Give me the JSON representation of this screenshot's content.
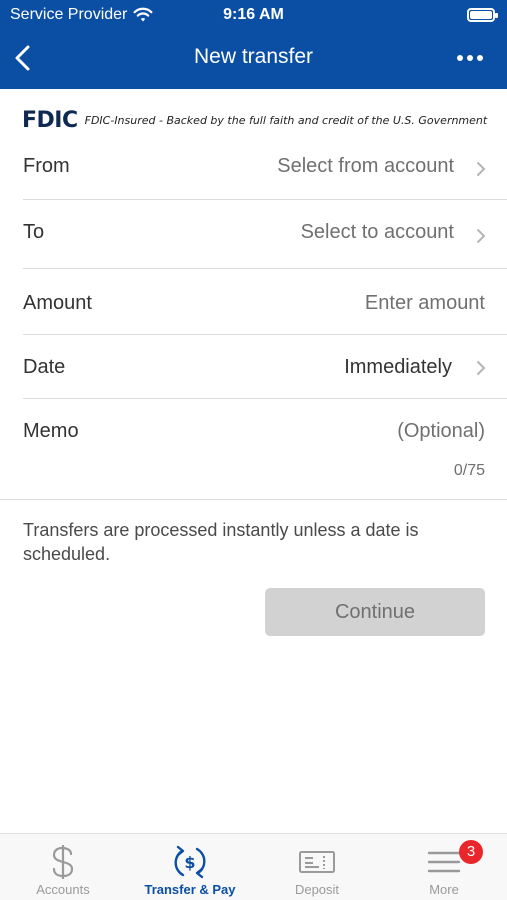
{
  "status_bar": {
    "carrier": "Service Provider",
    "time": "9:16 AM"
  },
  "header": {
    "title": "New transfer"
  },
  "fdic": {
    "logo": "FDIC",
    "text": "FDIC-Insured - Backed by the full faith and credit of the U.S. Government"
  },
  "form": {
    "from": {
      "label": "From",
      "value": "Select from account"
    },
    "to": {
      "label": "To",
      "value": "Select to account"
    },
    "amount": {
      "label": "Amount",
      "placeholder": "Enter amount"
    },
    "date": {
      "label": "Date",
      "value": "Immediately"
    },
    "memo": {
      "label": "Memo",
      "placeholder": "(Optional)",
      "counter": "0/75"
    }
  },
  "note": "Transfers are processed instantly unless a date is scheduled.",
  "continue_label": "Continue",
  "tabs": [
    {
      "label": "Accounts",
      "icon": "dollar-icon"
    },
    {
      "label": "Transfer & Pay",
      "icon": "transfer-pay-icon",
      "active": true
    },
    {
      "label": "Deposit",
      "icon": "check-deposit-icon"
    },
    {
      "label": "More",
      "icon": "menu-icon",
      "badge": "3"
    }
  ],
  "colors": {
    "brand": "#0b4fa5",
    "badge": "#e8262c",
    "button_disabled": "#d2d2d2"
  }
}
